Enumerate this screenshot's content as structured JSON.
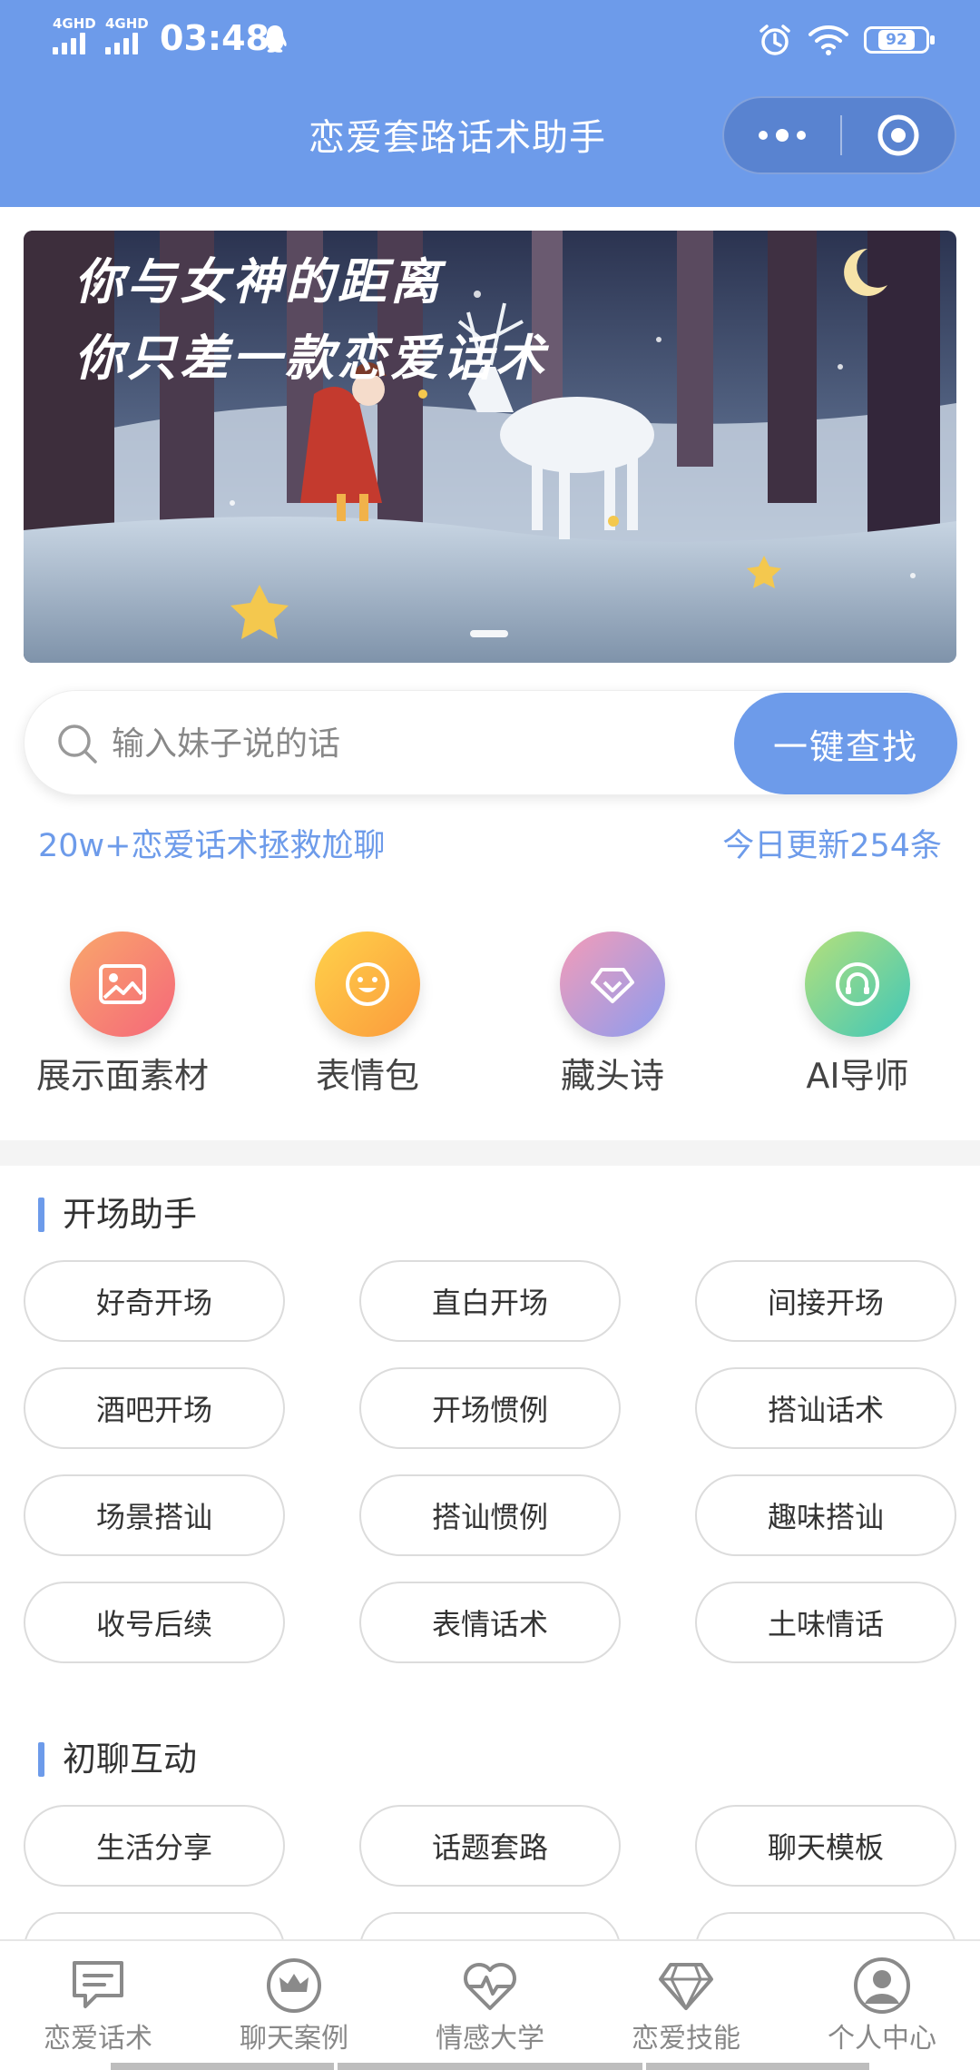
{
  "status_bar": {
    "net1": "4GHD",
    "net2": "4GHD",
    "time": "03:48",
    "battery": "92",
    "icons": [
      "signal-icon",
      "qq-icon",
      "alarm-icon",
      "wifi-icon",
      "battery-icon"
    ]
  },
  "header": {
    "title": "恋爱套路话术助手",
    "bg_color": "#6d9bea",
    "more_icon": "more-dots-icon",
    "close_icon": "target-close-icon"
  },
  "banner": {
    "line1": "你与女神的距离",
    "line2": "你只差一款恋爱话术",
    "page_indicator": 1
  },
  "search": {
    "placeholder": "输入妹子说的话",
    "value": "",
    "button": "一键查找"
  },
  "stats": {
    "left": "20w+恋爱话术拯救尬聊",
    "right": "今日更新254条"
  },
  "features": [
    {
      "label": "展示面素材",
      "icon": "image-icon"
    },
    {
      "label": "表情包",
      "icon": "smile-icon"
    },
    {
      "label": "藏头诗",
      "icon": "diamond-icon"
    },
    {
      "label": "AI导师",
      "icon": "headset-icon"
    }
  ],
  "section1": {
    "title": "开场助手",
    "items": [
      "好奇开场",
      "直白开场",
      "间接开场",
      "酒吧开场",
      "开场惯例",
      "搭讪话术",
      "场景搭讪",
      "搭讪惯例",
      "趣味搭讪",
      "收号后续",
      "表情话术",
      "土味情话"
    ]
  },
  "section2": {
    "title": "初聊互动",
    "items": [
      "生活分享",
      "话题套路",
      "聊天模板"
    ]
  },
  "tabbar": {
    "items": [
      {
        "label": "恋爱话术",
        "icon": "chat-bubble-icon"
      },
      {
        "label": "聊天案例",
        "icon": "crown-icon"
      },
      {
        "label": "情感大学",
        "icon": "heart-pulse-icon"
      },
      {
        "label": "恋爱技能",
        "icon": "diamond-icon"
      },
      {
        "label": "个人中心",
        "icon": "user-icon"
      }
    ]
  }
}
